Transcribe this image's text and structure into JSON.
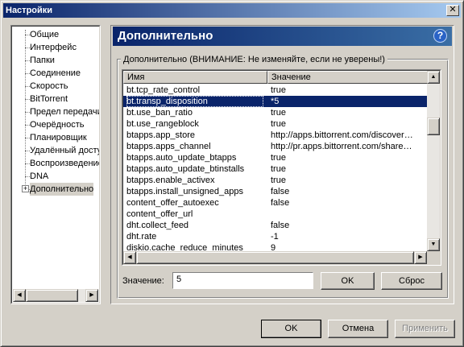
{
  "window": {
    "title": "Настройки",
    "close_symbol": "✕"
  },
  "tree": {
    "items": [
      {
        "label": "Общие"
      },
      {
        "label": "Интерфейс"
      },
      {
        "label": "Папки"
      },
      {
        "label": "Соединение"
      },
      {
        "label": "Скорость"
      },
      {
        "label": "BitTorrent"
      },
      {
        "label": "Предел передачи"
      },
      {
        "label": "Очерёдность"
      },
      {
        "label": "Планировщик"
      },
      {
        "label": "Удалённый доступ"
      },
      {
        "label": "Воспроизведение"
      },
      {
        "label": "DNA"
      },
      {
        "label": "Дополнительно"
      }
    ],
    "expander_symbol": "+"
  },
  "header": {
    "title": "Дополнительно",
    "help_symbol": "?"
  },
  "group": {
    "label": "Дополнительно (ВНИМАНИЕ: Не изменяйте, если не уверены!)"
  },
  "list": {
    "columns": {
      "name": "Имя",
      "value": "Значение"
    },
    "rows": [
      {
        "name": "bt.tcp_rate_control",
        "value": "true"
      },
      {
        "name": "bt.transp_disposition",
        "value": "*5",
        "selected": true
      },
      {
        "name": "bt.use_ban_ratio",
        "value": "true"
      },
      {
        "name": "bt.use_rangeblock",
        "value": "true"
      },
      {
        "name": "btapps.app_store",
        "value": "http://apps.bittorrent.com/discover…"
      },
      {
        "name": "btapps.apps_channel",
        "value": "http://pr.apps.bittorrent.com/share…"
      },
      {
        "name": "btapps.auto_update_btapps",
        "value": "true"
      },
      {
        "name": "btapps.auto_update_btinstalls",
        "value": "true"
      },
      {
        "name": "btapps.enable_activex",
        "value": "true"
      },
      {
        "name": "btapps.install_unsigned_apps",
        "value": "false"
      },
      {
        "name": "content_offer_autoexec",
        "value": "false"
      },
      {
        "name": "content_offer_url",
        "value": ""
      },
      {
        "name": "dht.collect_feed",
        "value": "false"
      },
      {
        "name": "dht.rate",
        "value": "-1"
      },
      {
        "name": "diskio.cache_reduce_minutes",
        "value": "9"
      }
    ]
  },
  "edit": {
    "label": "Значение:",
    "value": "5",
    "ok_label": "OK",
    "reset_label": "Сброс"
  },
  "footer": {
    "ok_label": "OK",
    "cancel_label": "Отмена",
    "apply_label": "Применить"
  },
  "scroll": {
    "up": "▲",
    "down": "▼",
    "left": "◀",
    "right": "▶"
  }
}
